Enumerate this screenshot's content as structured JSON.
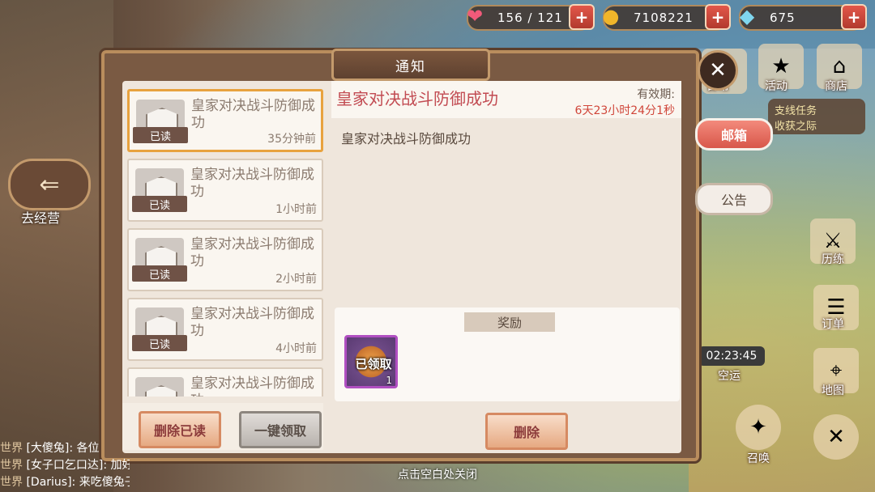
{
  "resources": [
    {
      "icon": "heart-icon",
      "glyph": "❤",
      "value": "156 / 121"
    },
    {
      "icon": "coin-icon",
      "glyph": "●",
      "value": "7108221"
    },
    {
      "icon": "gem-icon",
      "glyph": "◆",
      "value": "675"
    }
  ],
  "panel": {
    "title": "通知",
    "close_glyph": "✕"
  },
  "mails": [
    {
      "title": "皇家对决战斗防御成功",
      "tag": "已读",
      "time": "35分钟前"
    },
    {
      "title": "皇家对决战斗防御成功",
      "tag": "已读",
      "time": "1小时前"
    },
    {
      "title": "皇家对决战斗防御成功",
      "tag": "已读",
      "time": "2小时前"
    },
    {
      "title": "皇家对决战斗防御成功",
      "tag": "已读",
      "time": "4小时前"
    },
    {
      "title": "皇家对决战斗防御成功",
      "tag": "",
      "time": ""
    }
  ],
  "detail": {
    "title": "皇家对决战斗防御成功",
    "expire_label": "有效期:",
    "expire_value": "6天23小时24分1秒",
    "body": "皇家对决战斗防御成功",
    "reward_label": "奖励",
    "reward_item": {
      "status": "已领取",
      "count": "1"
    }
  },
  "buttons": {
    "delete_read": "删除已读",
    "claim_all": "一键领取",
    "delete": "删除"
  },
  "side_tabs": {
    "mail": "邮箱",
    "notice": "公告"
  },
  "right_menu": {
    "daily": "日常",
    "events": "活动",
    "shop": "商店",
    "quest_line1": "支线任务",
    "quest_line2": "收获之际",
    "training": "历练",
    "orders": "订单",
    "timer": "02:23:45",
    "shipping": "空运",
    "map": "地图",
    "summon": "召唤"
  },
  "left": {
    "back_label": "去经营"
  },
  "chat": [
    {
      "channel": "世界",
      "text": "[大傻兔]: 各位"
    },
    {
      "channel": "世界",
      "text": "[女子口乞口达]: 加好友咯"
    },
    {
      "channel": "世界",
      "text": "[Darius]: 来吃傻兔子🐰"
    }
  ],
  "hint": "点击空白处关闭"
}
